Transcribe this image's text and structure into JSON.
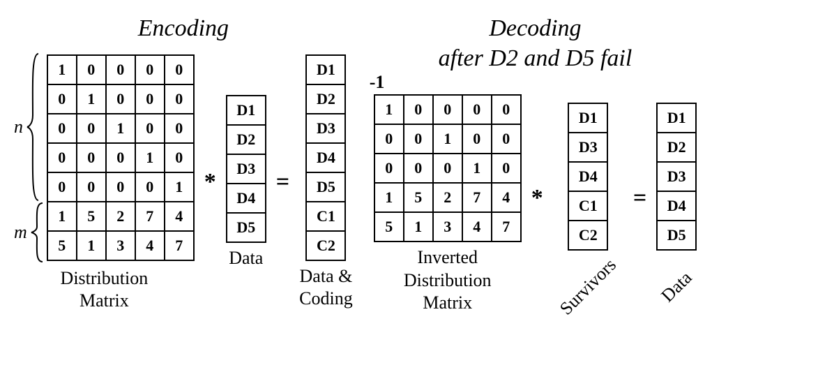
{
  "encoding": {
    "title": "Encoding",
    "n_label": "n",
    "m_label": "m",
    "dist_matrix": {
      "rows": [
        [
          "1",
          "0",
          "0",
          "0",
          "0"
        ],
        [
          "0",
          "1",
          "0",
          "0",
          "0"
        ],
        [
          "0",
          "0",
          "1",
          "0",
          "0"
        ],
        [
          "0",
          "0",
          "0",
          "1",
          "0"
        ],
        [
          "0",
          "0",
          "0",
          "0",
          "1"
        ],
        [
          "1",
          "5",
          "2",
          "7",
          "4"
        ],
        [
          "5",
          "1",
          "3",
          "4",
          "7"
        ]
      ],
      "caption": "Distribution\nMatrix"
    },
    "op_mult": "*",
    "data_vector": {
      "items": [
        "D1",
        "D2",
        "D3",
        "D4",
        "D5"
      ],
      "caption": "Data"
    },
    "op_eq": "=",
    "result_vector": {
      "items": [
        "D1",
        "D2",
        "D3",
        "D4",
        "D5",
        "C1",
        "C2"
      ],
      "caption": "Data &\nCoding"
    }
  },
  "decoding": {
    "title": "Decoding\nafter D2 and D5 fail",
    "exponent": "-1",
    "inv_matrix": {
      "rows": [
        [
          "1",
          "0",
          "0",
          "0",
          "0"
        ],
        [
          "0",
          "0",
          "1",
          "0",
          "0"
        ],
        [
          "0",
          "0",
          "0",
          "1",
          "0"
        ],
        [
          "1",
          "5",
          "2",
          "7",
          "4"
        ],
        [
          "5",
          "1",
          "3",
          "4",
          "7"
        ]
      ],
      "caption": "Inverted\nDistribution\nMatrix"
    },
    "op_mult": "*",
    "survivors_vector": {
      "items": [
        "D1",
        "D3",
        "D4",
        "C1",
        "C2"
      ],
      "caption": "Survivors"
    },
    "op_eq": "=",
    "data_vector": {
      "items": [
        "D1",
        "D2",
        "D3",
        "D4",
        "D5"
      ],
      "caption": "Data"
    }
  }
}
